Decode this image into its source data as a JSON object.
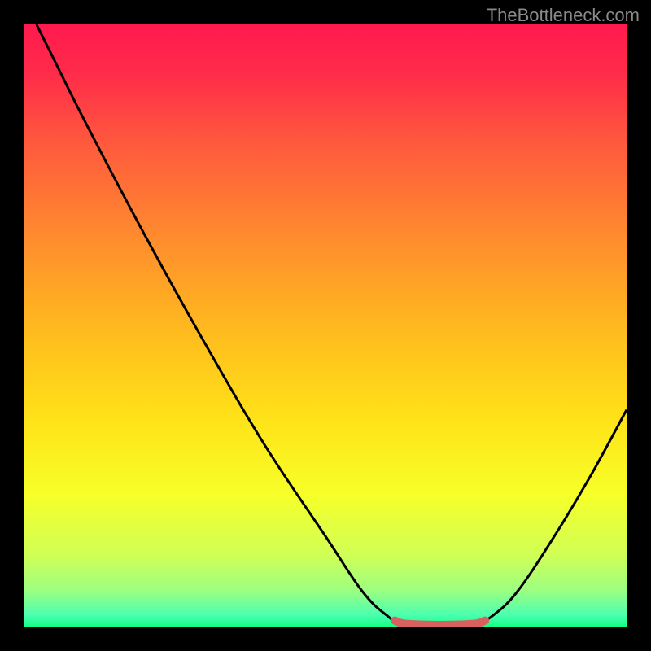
{
  "watermark": "TheBottleneck.com",
  "chart_data": {
    "type": "line",
    "title": "",
    "xlabel": "",
    "ylabel": "",
    "xlim": [
      0,
      100
    ],
    "ylim": [
      0,
      100
    ],
    "gradient_stops": [
      {
        "offset": 0.0,
        "color": "#ff1a4e"
      },
      {
        "offset": 0.08,
        "color": "#ff2b4a"
      },
      {
        "offset": 0.2,
        "color": "#ff5a3d"
      },
      {
        "offset": 0.35,
        "color": "#ff8a2e"
      },
      {
        "offset": 0.5,
        "color": "#ffb81f"
      },
      {
        "offset": 0.65,
        "color": "#ffe118"
      },
      {
        "offset": 0.78,
        "color": "#f7ff28"
      },
      {
        "offset": 0.88,
        "color": "#d0ff55"
      },
      {
        "offset": 0.94,
        "color": "#9cff80"
      },
      {
        "offset": 0.98,
        "color": "#4dffb0"
      },
      {
        "offset": 1.0,
        "color": "#14ff87"
      }
    ],
    "series": [
      {
        "name": "bottleneck-curve",
        "color": "#000000",
        "points": [
          {
            "x": 2,
            "y": 100
          },
          {
            "x": 5,
            "y": 94
          },
          {
            "x": 10,
            "y": 84
          },
          {
            "x": 20,
            "y": 65
          },
          {
            "x": 30,
            "y": 47
          },
          {
            "x": 40,
            "y": 30
          },
          {
            "x": 50,
            "y": 15
          },
          {
            "x": 56,
            "y": 6
          },
          {
            "x": 60,
            "y": 2
          },
          {
            "x": 63,
            "y": 0.5
          },
          {
            "x": 70,
            "y": 0.5
          },
          {
            "x": 75,
            "y": 0.5
          },
          {
            "x": 78,
            "y": 2
          },
          {
            "x": 82,
            "y": 6
          },
          {
            "x": 88,
            "y": 15
          },
          {
            "x": 94,
            "y": 25
          },
          {
            "x": 100,
            "y": 36
          }
        ]
      },
      {
        "name": "optimal-segment",
        "color": "#d96060",
        "points": [
          {
            "x": 61.5,
            "y": 1.0
          },
          {
            "x": 63,
            "y": 0.5
          },
          {
            "x": 67,
            "y": 0.3
          },
          {
            "x": 71,
            "y": 0.3
          },
          {
            "x": 75,
            "y": 0.5
          },
          {
            "x": 76.5,
            "y": 1.0
          }
        ]
      }
    ]
  }
}
